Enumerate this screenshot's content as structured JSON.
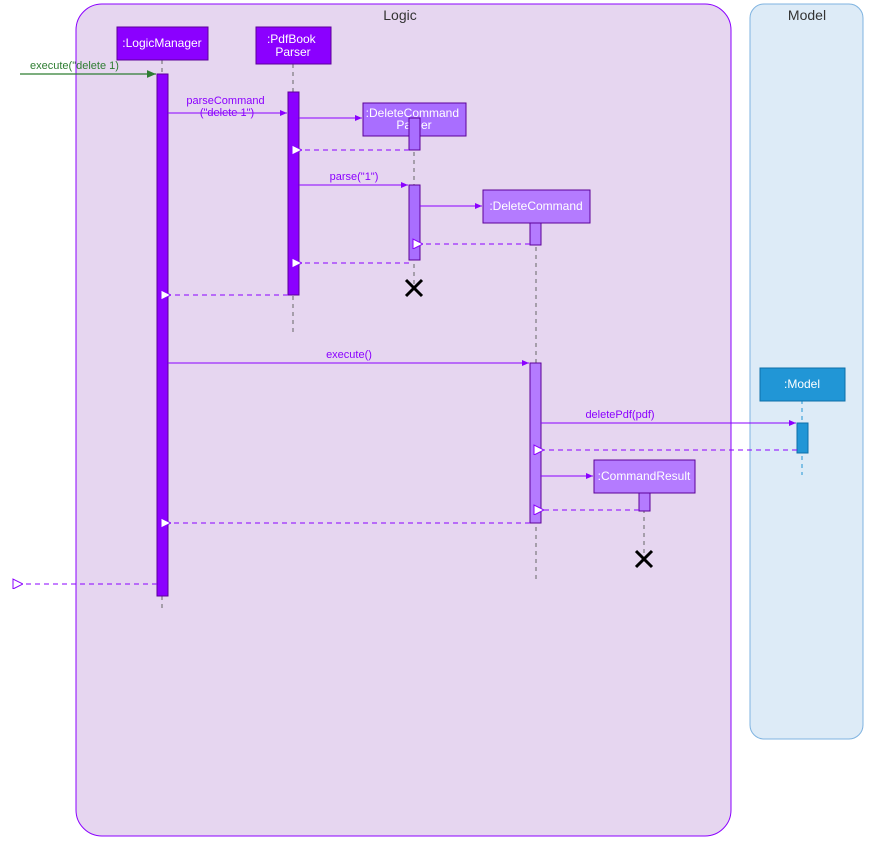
{
  "frames": {
    "logic": {
      "title": "Logic"
    },
    "model": {
      "title": "Model"
    }
  },
  "participants": {
    "logicManager": ":LogicManager",
    "pdfBookParser": ":PdfBook\nParser",
    "deleteCommandParser": ":DeleteCommand\nParser",
    "deleteCommand": ":DeleteCommand",
    "model": ":Model",
    "commandResult": ":CommandResult"
  },
  "messages": {
    "entry": "execute(\"delete 1)",
    "parseCommand1": "parseCommand",
    "parseCommand2": "(\"delete 1\")",
    "parse": "parse(\"1\")",
    "execute": "execute()",
    "deletePdf": "deletePdf(pdf)"
  },
  "colors": {
    "darkPurple": "#8B00FF",
    "midPurple": "#A96EFF",
    "lightPurple": "#B47BFF",
    "frameLogic": "#E6D6F0",
    "frameModel": "#DDEBF7",
    "frameModelBorder": "#7FB3E0",
    "blue": "#2196D6"
  }
}
